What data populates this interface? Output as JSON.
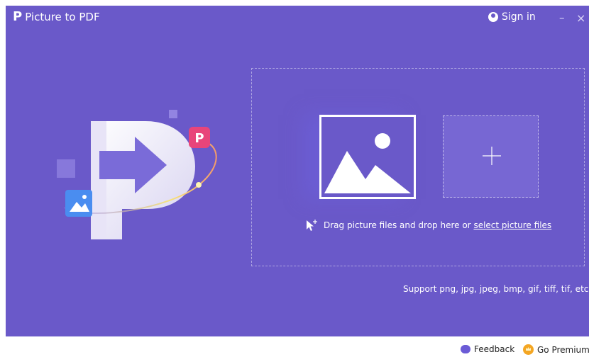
{
  "app": {
    "logo_letter": "P",
    "title": "Picture to PDF",
    "sign_in": "Sign in",
    "minimize": "–",
    "close": "×"
  },
  "dropzone": {
    "add_symbol": "+",
    "drag_text": "Drag picture files and drop here or ",
    "select_link": "select picture files"
  },
  "support_text": "Support png, jpg, jpeg, bmp, gif, tiff, tif, etc.",
  "footer": {
    "feedback": "Feedback",
    "go_premium": "Go Premium"
  },
  "colors": {
    "background": "#6a59c9",
    "accent_pink": "#e8457a",
    "image_badge": "#4a8df0",
    "premium_gold": "#f4a623"
  }
}
